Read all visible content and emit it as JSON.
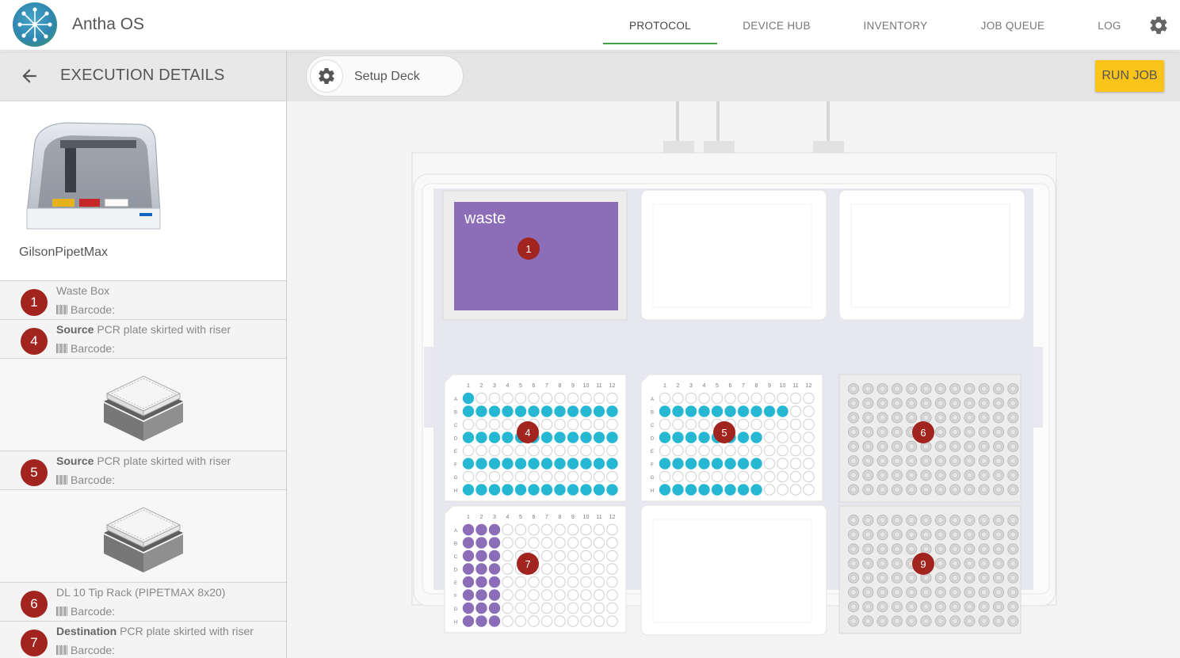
{
  "app": {
    "title": "Antha OS"
  },
  "nav": [
    {
      "label": "PROTOCOL",
      "active": true
    },
    {
      "label": "DEVICE HUB",
      "active": false
    },
    {
      "label": "INVENTORY",
      "active": false
    },
    {
      "label": "JOB QUEUE",
      "active": false
    },
    {
      "label": "LOG",
      "active": false
    }
  ],
  "left": {
    "title": "EXECUTION DETAILS",
    "device_name": "GilsonPipetMax",
    "items": [
      {
        "badge": "1",
        "prefix": "",
        "name": "Waste Box",
        "barcode": "Barcode:"
      },
      {
        "badge": "4",
        "prefix": "Source",
        "name": " PCR plate skirted with riser",
        "barcode": "Barcode:"
      },
      {
        "badge": "5",
        "prefix": "Source",
        "name": " PCR plate skirted with riser",
        "barcode": "Barcode:"
      },
      {
        "badge": "6",
        "prefix": "",
        "name": "DL 10 Tip Rack (PIPETMAX 8x20)",
        "barcode": "Barcode:"
      },
      {
        "badge": "7",
        "prefix": "Destination",
        "name": " PCR plate skirted with riser",
        "barcode": "Barcode:"
      }
    ]
  },
  "main": {
    "setup_label": "Setup Deck",
    "run_label": "RUN JOB"
  },
  "deck": {
    "waste_label": "waste",
    "badges": {
      "p1": "1",
      "p4": "4",
      "p5": "5",
      "p6": "6",
      "p7": "7",
      "p9": "9"
    },
    "col_labels": [
      "1",
      "2",
      "3",
      "4",
      "5",
      "6",
      "7",
      "8",
      "9",
      "10",
      "11",
      "12"
    ],
    "row_labels": [
      "A",
      "B",
      "C",
      "D",
      "E",
      "F",
      "G",
      "H"
    ],
    "plate4_filled": [
      "A1",
      "B1",
      "B2",
      "B3",
      "B4",
      "B5",
      "B6",
      "B7",
      "B8",
      "B9",
      "B10",
      "B11",
      "B12",
      "D1",
      "D2",
      "D3",
      "D4",
      "D5",
      "D6",
      "D7",
      "D8",
      "D9",
      "D10",
      "D11",
      "D12",
      "F1",
      "F2",
      "F3",
      "F4",
      "F5",
      "F6",
      "F7",
      "F8",
      "F9",
      "F10",
      "F11",
      "F12",
      "H1",
      "H2",
      "H3",
      "H4",
      "H5",
      "H6",
      "H7",
      "H8",
      "H9",
      "H10",
      "H11",
      "H12"
    ],
    "plate5_filled": [
      "B1",
      "B2",
      "B3",
      "B4",
      "B5",
      "B6",
      "B7",
      "B8",
      "B9",
      "B10",
      "D1",
      "D2",
      "D3",
      "D4",
      "D5",
      "D6",
      "D7",
      "D8",
      "F1",
      "F2",
      "F3",
      "F4",
      "F5",
      "F6",
      "F7",
      "F8",
      "H1",
      "H2",
      "H3",
      "H4",
      "H5",
      "H6",
      "H7",
      "H8"
    ],
    "plate7_filled_columns": 3,
    "colors": {
      "cyan": "#26b8d3",
      "purple": "#8c6db7",
      "waste": "#8b6db8",
      "badge": "#a1241f",
      "run": "#fbc419"
    }
  }
}
